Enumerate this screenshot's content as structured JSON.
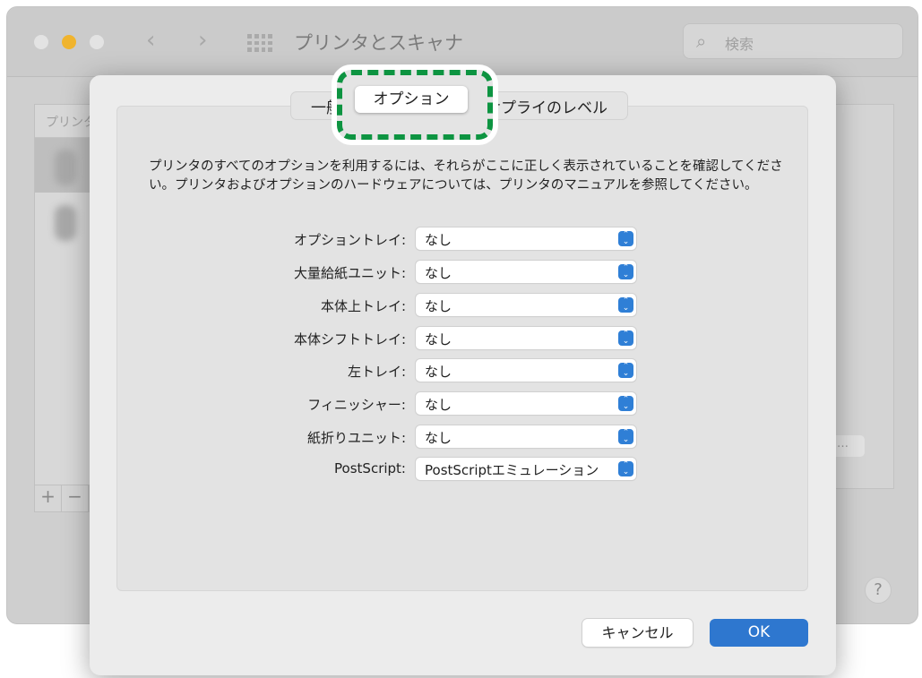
{
  "window": {
    "title": "プリンタとスキャナ",
    "search_placeholder": "検索",
    "list_header": "プリンタ",
    "more_button": "…",
    "help": "?",
    "add": "+",
    "remove": "−"
  },
  "colors": {
    "accent": "#2e77cf",
    "highlight": "#0d9441",
    "traffic_yellow": "#f0b42e"
  },
  "sheet": {
    "tabs": [
      {
        "label": "一般"
      },
      {
        "label": "オプション",
        "active": true
      },
      {
        "label": "サプライのレベル"
      }
    ],
    "description": "プリンタのすべてのオプションを利用するには、それらがここに正しく表示されていることを確認してください。プリンタおよびオプションのハードウェアについては、プリンタのマニュアルを参照してください。",
    "options": [
      {
        "label": "オプショントレイ:",
        "value": "なし"
      },
      {
        "label": "大量給紙ユニット:",
        "value": "なし"
      },
      {
        "label": "本体上トレイ:",
        "value": "なし"
      },
      {
        "label": "本体シフトトレイ:",
        "value": "なし"
      },
      {
        "label": "左トレイ:",
        "value": "なし"
      },
      {
        "label": "フィニッシャー:",
        "value": "なし"
      },
      {
        "label": "紙折りユニット:",
        "value": "なし"
      },
      {
        "label": "PostScript:",
        "value": "PostScriptエミュレーション"
      }
    ],
    "cancel": "キャンセル",
    "ok": "OK"
  }
}
